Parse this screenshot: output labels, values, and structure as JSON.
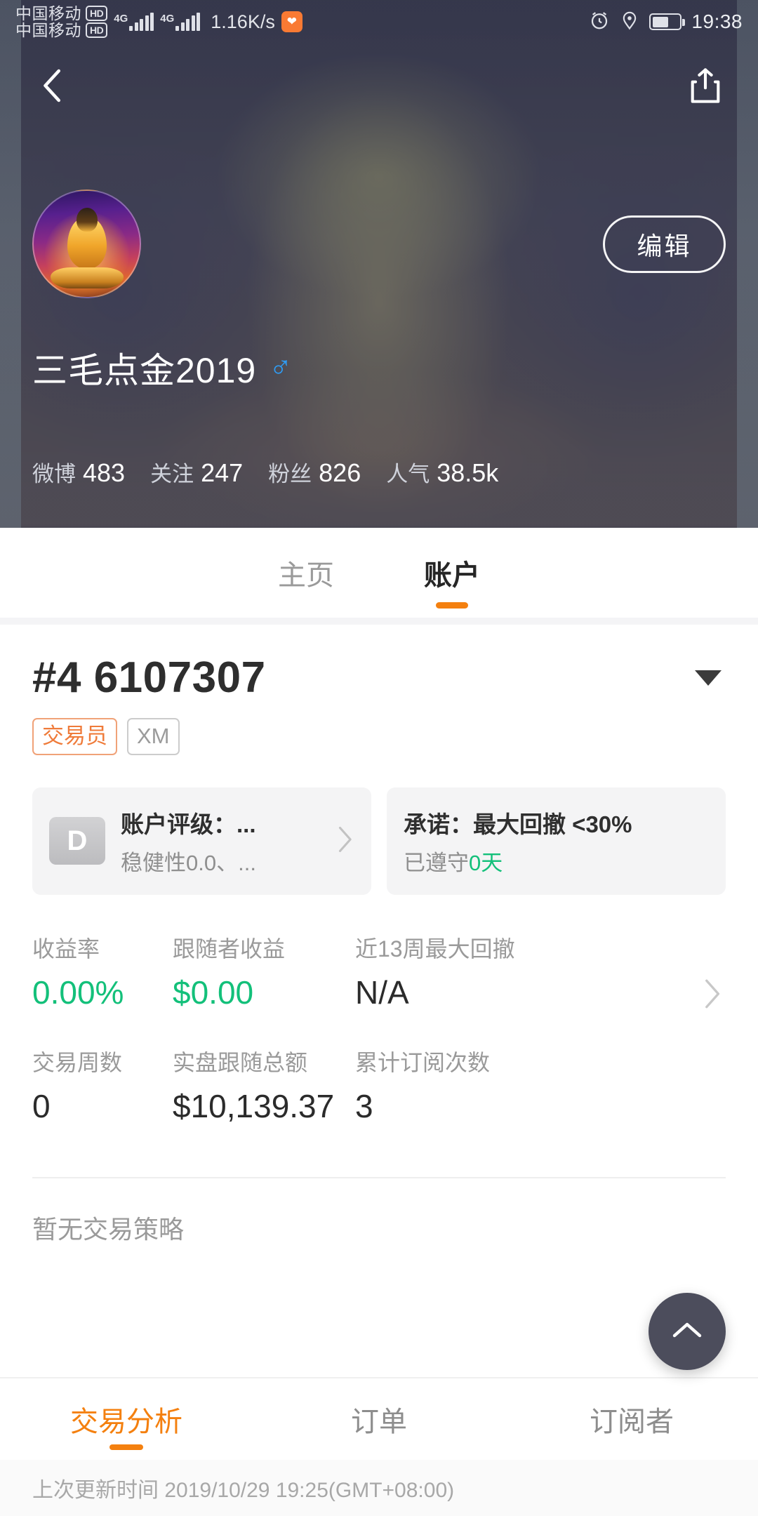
{
  "status_bar": {
    "carriers": [
      {
        "name": "中国移动",
        "hd": "HD"
      },
      {
        "name": "中国移动",
        "hd": "HD"
      }
    ],
    "net_type_1": "4G",
    "net_type_2": "4G",
    "data_speed": "1.16K/s",
    "health_icon": "heart-icon",
    "alarm_icon": "alarm-icon",
    "location_icon": "location-pin-icon",
    "battery_icon": "battery-icon",
    "time": "19:38"
  },
  "hero": {
    "back_icon": "back-chevron-icon",
    "share_icon": "share-icon",
    "avatar_icon": "buddha-avatar",
    "edit_label": "编辑",
    "display_name": "三毛点金2019",
    "gender_symbol": "♂",
    "stats": [
      {
        "label": "微博",
        "value": "483"
      },
      {
        "label": "关注",
        "value": "247"
      },
      {
        "label": "粉丝",
        "value": "826"
      },
      {
        "label": "人气",
        "value": "38.5k"
      }
    ]
  },
  "top_tabs": [
    {
      "label": "主页",
      "active": false
    },
    {
      "label": "账户",
      "active": true
    }
  ],
  "account": {
    "id": "#4 6107307",
    "dropdown_icon": "chevron-down-icon",
    "badges": [
      {
        "label": "交易员",
        "type": "trader"
      },
      {
        "label": "XM",
        "type": "broker"
      }
    ],
    "rating_card": {
      "grade": "D",
      "title": "账户评级：...",
      "subtitle": "稳健性0.0、...",
      "chevron_icon": "chevron-right-icon"
    },
    "promise_card": {
      "title": "承诺：最大回撤 <30%",
      "sub_prefix": "已遵守",
      "sub_value": "0天"
    },
    "metrics": [
      [
        {
          "label": "收益率",
          "value": "0.00%",
          "color": "green"
        },
        {
          "label": "跟随者收益",
          "value": "$0.00",
          "color": "green"
        },
        {
          "label": "近13周最大回撤",
          "value": "N/A",
          "color": "dark"
        }
      ],
      [
        {
          "label": "交易周数",
          "value": "0",
          "color": "dark"
        },
        {
          "label": "实盘跟随总额",
          "value": "$10,139.37",
          "color": "dark"
        },
        {
          "label": "累计订阅次数",
          "value": "3",
          "color": "dark"
        }
      ]
    ],
    "metrics_chevron_icon": "chevron-right-icon",
    "no_strategy": "暂无交易策略"
  },
  "bottom_tabs": [
    {
      "label": "交易分析",
      "active": true
    },
    {
      "label": "订单",
      "active": false
    },
    {
      "label": "订阅者",
      "active": false
    }
  ],
  "footer": {
    "last_update": "上次更新时间 2019/10/29 19:25(GMT+08:00)"
  },
  "fab": {
    "icon": "chevron-up-icon"
  },
  "colors": {
    "accent_orange": "#f4800f",
    "green": "#13c07a",
    "badge_trader": "#ef7b3a",
    "fab_bg": "#4c4d5c"
  }
}
